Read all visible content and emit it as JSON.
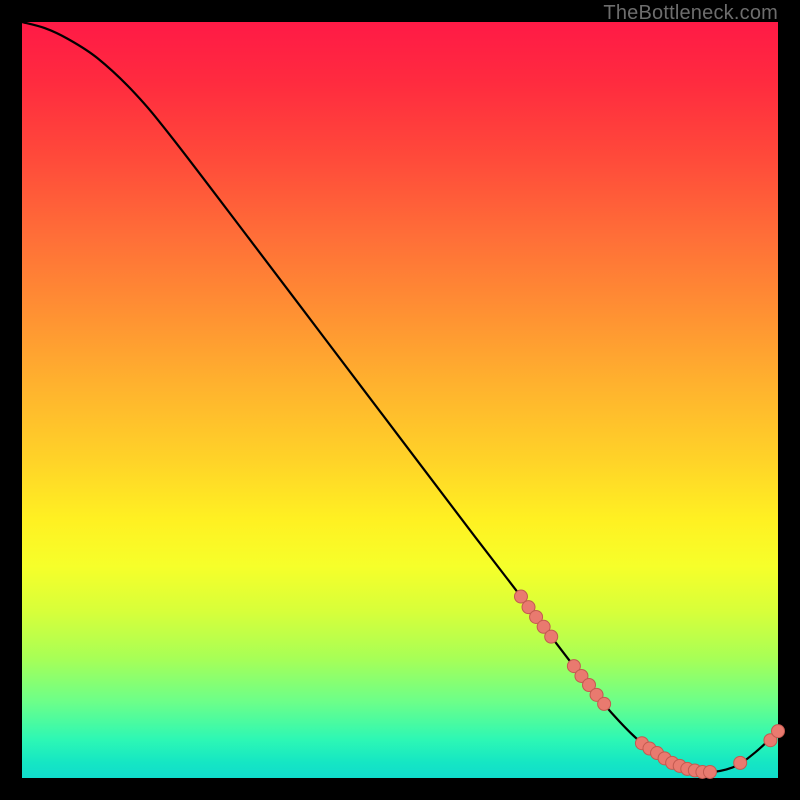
{
  "watermark": "TheBottleneck.com",
  "colors": {
    "line": "#000000",
    "marker_fill": "#e97a6f",
    "marker_stroke": "#c35a50"
  },
  "chart_data": {
    "type": "line",
    "title": "",
    "xlabel": "",
    "ylabel": "",
    "xlim": [
      0,
      100
    ],
    "ylim": [
      0,
      100
    ],
    "curve": {
      "x": [
        0,
        3,
        6,
        10,
        15,
        20,
        30,
        40,
        50,
        60,
        66,
        70,
        74,
        78,
        82,
        86,
        90,
        94,
        97,
        100
      ],
      "y": [
        100,
        99.2,
        97.8,
        95.2,
        90.5,
        84.5,
        71.4,
        58.2,
        45.0,
        31.8,
        24.0,
        18.7,
        13.5,
        8.6,
        4.6,
        2.0,
        0.8,
        1.4,
        3.4,
        6.2
      ]
    },
    "markers": [
      {
        "x": 66,
        "y": 24.0
      },
      {
        "x": 67,
        "y": 22.6
      },
      {
        "x": 68,
        "y": 21.3
      },
      {
        "x": 69,
        "y": 20.0
      },
      {
        "x": 70,
        "y": 18.7
      },
      {
        "x": 73,
        "y": 14.8
      },
      {
        "x": 74,
        "y": 13.5
      },
      {
        "x": 75,
        "y": 12.3
      },
      {
        "x": 76,
        "y": 11.0
      },
      {
        "x": 77,
        "y": 9.8
      },
      {
        "x": 82,
        "y": 4.6
      },
      {
        "x": 83,
        "y": 3.9
      },
      {
        "x": 84,
        "y": 3.3
      },
      {
        "x": 85,
        "y": 2.6
      },
      {
        "x": 86,
        "y": 2.0
      },
      {
        "x": 87,
        "y": 1.6
      },
      {
        "x": 88,
        "y": 1.2
      },
      {
        "x": 89,
        "y": 1.0
      },
      {
        "x": 90,
        "y": 0.8
      },
      {
        "x": 91,
        "y": 0.8
      },
      {
        "x": 95,
        "y": 2.0
      },
      {
        "x": 99,
        "y": 5.0
      },
      {
        "x": 100,
        "y": 6.2
      }
    ]
  }
}
